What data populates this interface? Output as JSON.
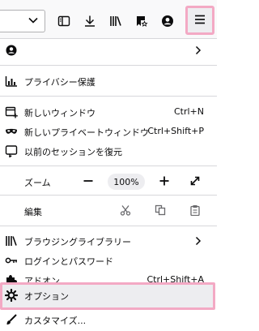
{
  "toolbar": {
    "icons": [
      "sidebar-icon",
      "download-icon",
      "library-icon",
      "bookmarks-icon",
      "account-icon",
      "hamburger-menu-icon"
    ]
  },
  "menu": {
    "account_arrow": "›",
    "privacy": "プライバシー保護",
    "new_window": "新しいウィンドウ",
    "new_window_shortcut": "Ctrl+N",
    "new_private_window": "新しいプライベートウィンドウ",
    "new_private_window_shortcut": "Ctrl+Shift+P",
    "restore_session": "以前のセッションを復元",
    "zoom_label": "ズーム",
    "zoom_minus": "—",
    "zoom_value": "100%",
    "zoom_plus": "+",
    "edit_label": "編集",
    "library": "ブラウジングライブラリー",
    "logins": "ログインとパスワード",
    "addons": "アドオン",
    "addons_shortcut": "Ctrl+Shift+A",
    "options": "オプション",
    "customize": "カスタマイズ..."
  },
  "colors": {
    "highlight_border": "#f3a9c4",
    "hover_bg": "#ededf0"
  }
}
